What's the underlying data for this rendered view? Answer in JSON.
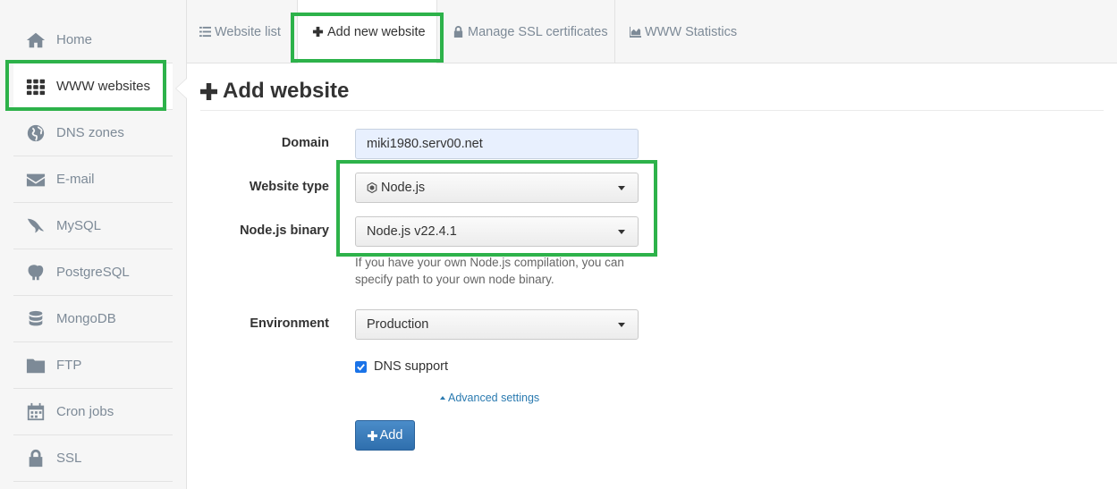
{
  "sidebar": {
    "items": [
      {
        "label": "Home",
        "icon": "home-icon"
      },
      {
        "label": "WWW websites",
        "icon": "grid-icon",
        "active": true
      },
      {
        "label": "DNS zones",
        "icon": "globe-icon"
      },
      {
        "label": "E-mail",
        "icon": "envelope-icon"
      },
      {
        "label": "MySQL",
        "icon": "dolphin-icon"
      },
      {
        "label": "PostgreSQL",
        "icon": "elephant-icon"
      },
      {
        "label": "MongoDB",
        "icon": "database-icon"
      },
      {
        "label": "FTP",
        "icon": "folder-icon"
      },
      {
        "label": "Cron jobs",
        "icon": "calendar-icon"
      },
      {
        "label": "SSL",
        "icon": "lock-icon"
      }
    ]
  },
  "tabs": [
    {
      "label": "Website list",
      "icon": "list-icon"
    },
    {
      "label": "Add new website",
      "icon": "plus-icon",
      "active": true
    },
    {
      "label": "Manage SSL certificates",
      "icon": "lock-icon"
    },
    {
      "label": "WWW Statistics",
      "icon": "area-chart-icon"
    }
  ],
  "main": {
    "title": "Add website",
    "form": {
      "domain_label": "Domain",
      "domain_value": "miki1980.serv00.net",
      "website_type_label": "Website type",
      "website_type_value": "Node.js",
      "node_binary_label": "Node.js binary",
      "node_binary_value": "Node.js v22.4.1",
      "node_binary_help": "If you have your own Node.js compilation, you can specify path to your own node binary.",
      "environment_label": "Environment",
      "environment_value": "Production",
      "dns_support_label": "DNS support",
      "dns_support_checked": true,
      "advanced_settings_label": "Advanced settings",
      "add_button_label": "Add"
    }
  },
  "colors": {
    "highlight": "#2db24a",
    "primary_button": "#2f6fad",
    "link": "#2a7ab0",
    "checkbox": "#1a73e8"
  }
}
